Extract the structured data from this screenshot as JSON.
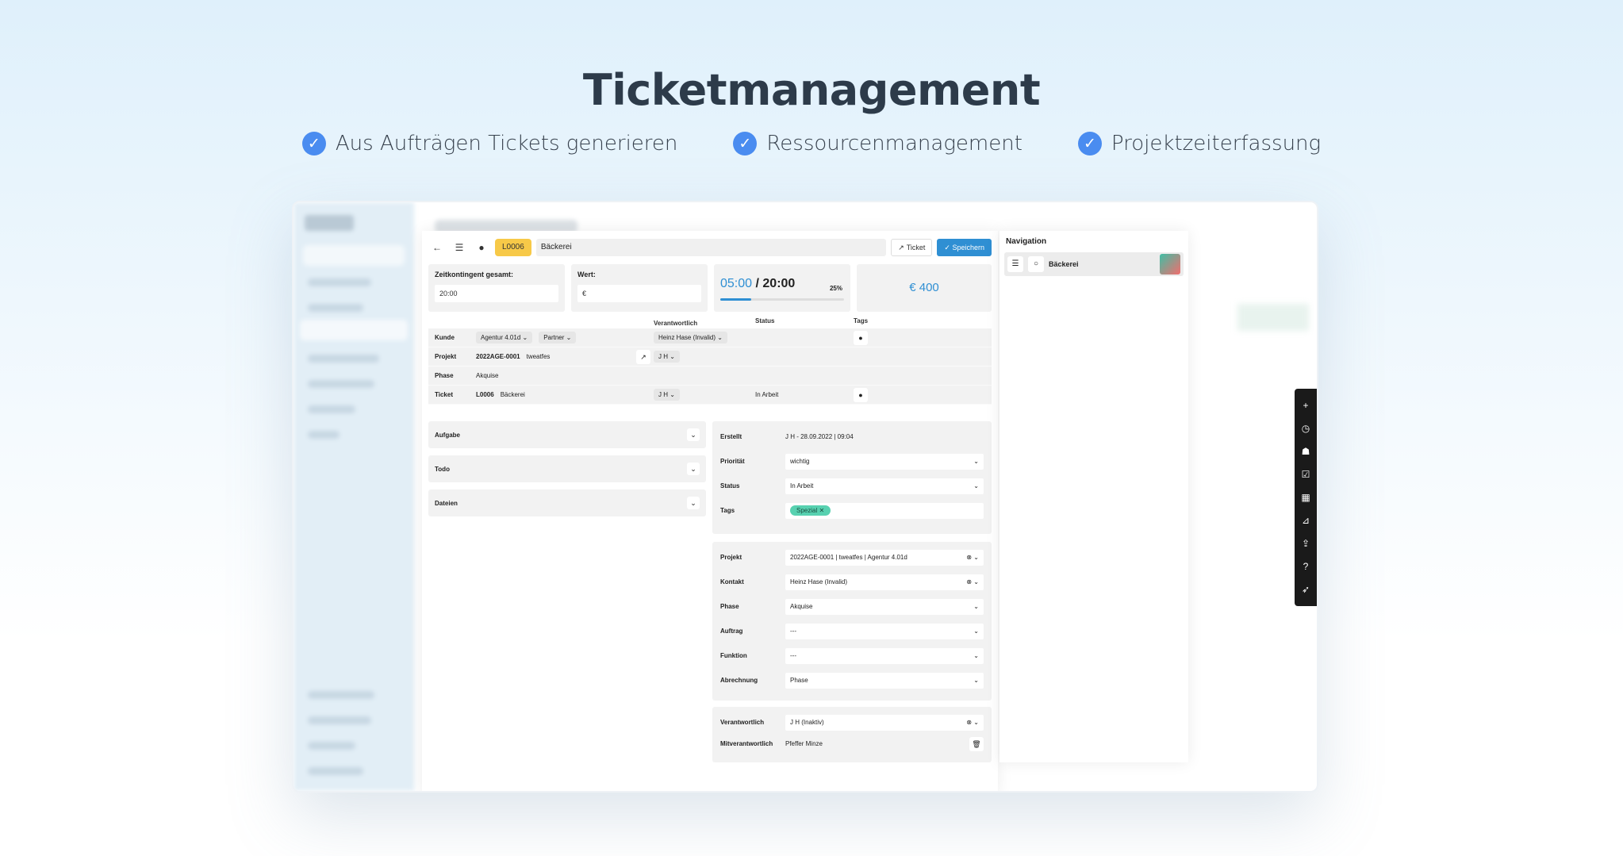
{
  "hero": {
    "title": "Ticketmanagement",
    "features": [
      "Aus Aufträgen Tickets generieren",
      "Ressourcenmanagement",
      "Projektzeiterfassung"
    ]
  },
  "ticket": {
    "number": "L0006",
    "title": "Bäckerei",
    "btn_ticket": "Ticket",
    "btn_save": "✓ Speichern"
  },
  "cards": {
    "budget_label": "Zeitkontingent gesamt:",
    "budget_value": "20:00",
    "value_label": "Wert:",
    "value_placeholder": "€",
    "time_used": "05:00",
    "time_sep": " / ",
    "time_total": "20:00",
    "progress_percent": 25,
    "progress_label": "25%",
    "value_total": "€ 400"
  },
  "info_table": {
    "headers": [
      "",
      "",
      "Verantwortlich",
      "Status",
      "Tags"
    ],
    "rows": [
      {
        "label": "Kunde",
        "main": [
          "Agentur 4.01d ⌄",
          "Partner ⌄"
        ],
        "resp": "Heinz Hase (Invalid) ⌄",
        "status": "",
        "tag": "●"
      },
      {
        "label": "Projekt",
        "main_bold": "2022AGE-0001",
        "main_rest": "tweatfes",
        "resp": "J H ⌄",
        "status": "",
        "tag": ""
      },
      {
        "label": "Phase",
        "main_rest": "Akquise",
        "resp": "",
        "status": "",
        "tag": ""
      },
      {
        "label": "Ticket",
        "main_bold": "L0006",
        "main_rest": "Bäckerei",
        "resp": "J H ⌄",
        "status": "In Arbeit",
        "tag": "●"
      }
    ]
  },
  "accordions": [
    "Aufgabe",
    "Todo",
    "Dateien"
  ],
  "details1": {
    "created_label": "Erstellt",
    "created_value": "J H - 28.09.2022 | 09:04",
    "priority_label": "Priorität",
    "priority_value": "wichtig",
    "status_label": "Status",
    "status_value": "In Arbeit",
    "tags_label": "Tags",
    "tag_value": "Spezial"
  },
  "details2": {
    "projekt_label": "Projekt",
    "projekt_value": "2022AGE-0001 | tweatfes | Agentur 4.01d",
    "kontakt_label": "Kontakt",
    "kontakt_value": "Heinz Hase (Invalid)",
    "phase_label": "Phase",
    "phase_value": "Akquise",
    "auftrag_label": "Auftrag",
    "auftrag_value": "---",
    "funktion_label": "Funktion",
    "funktion_value": "---",
    "abrechnung_label": "Abrechnung",
    "abrechnung_value": "Phase"
  },
  "details3": {
    "resp_label": "Verantwortlich",
    "resp_value": "J H (Inaktiv)",
    "coresp_label": "Mitverantwortlich",
    "coresp_value": "Pfeffer Minze"
  },
  "navigation": {
    "title": "Navigation",
    "item": "Bäckerei"
  },
  "colors": {
    "accent": "#2f8fd3",
    "ticket_badge": "#f7c948",
    "tag": "#57d1b0",
    "feature_check": "#4a8cf0"
  }
}
